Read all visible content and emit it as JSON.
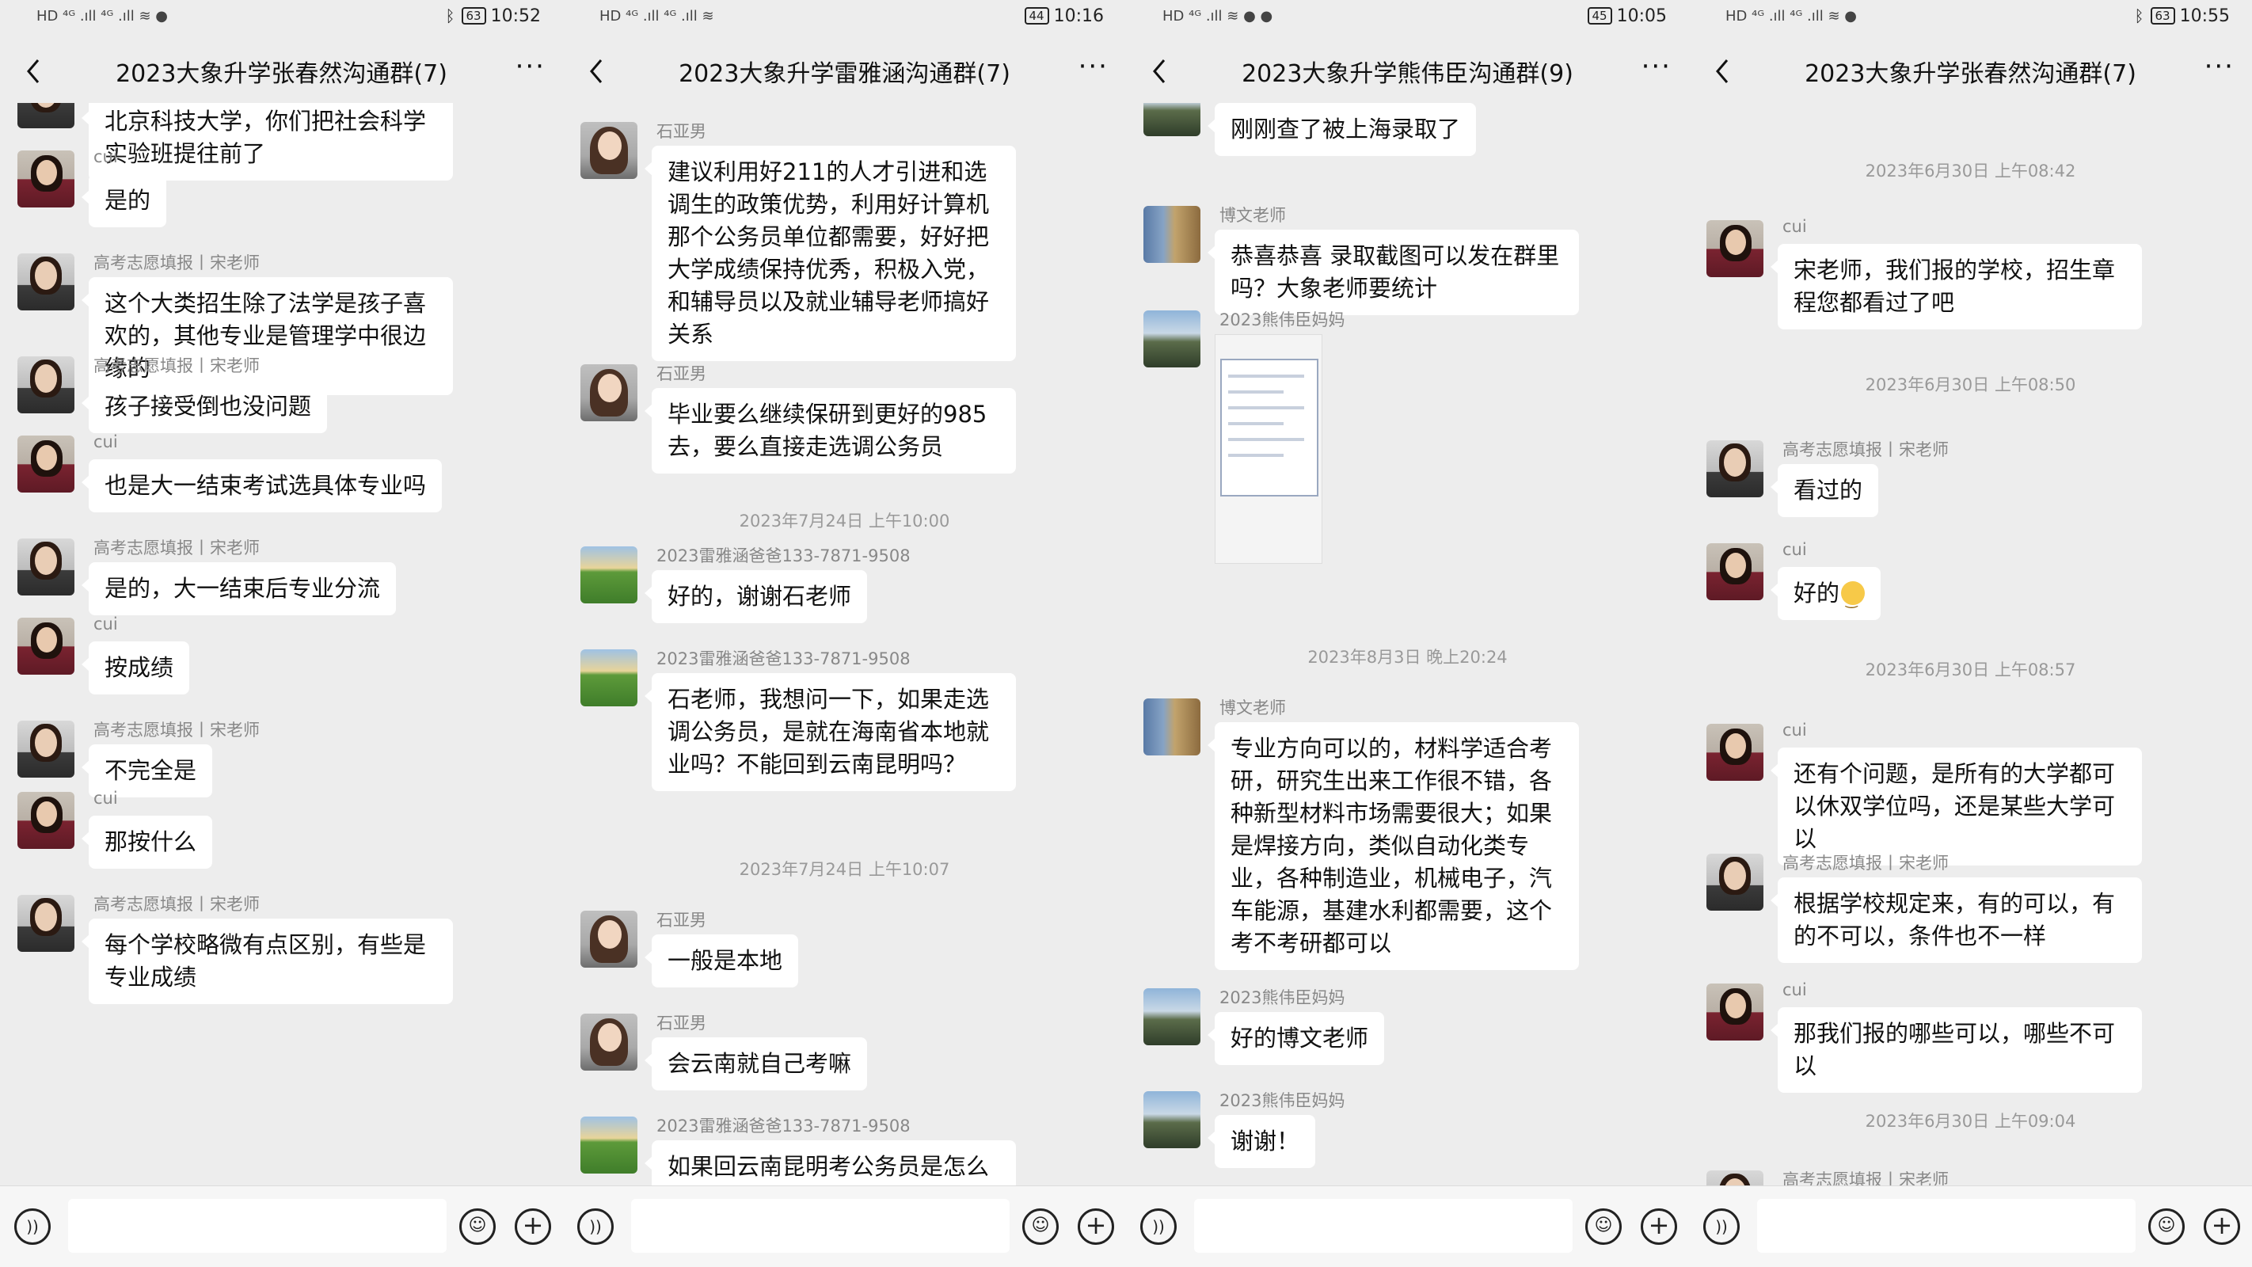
{
  "screens": [
    {
      "status": {
        "left": "HD ⁴ᴳ .ıll ⁴ᴳ .ıll ≋ ●",
        "battery": "63",
        "time": "10:52",
        "bluetooth": true
      },
      "title": "2023大象升学张春然沟通群(7)",
      "items": [
        {
          "kind": "msg",
          "avatar": "person",
          "sender": "高考志愿填报丨宋老师",
          "text": "北京科技大学，你们把社会科学实验班提往前了"
        },
        {
          "kind": "msg",
          "avatar": "cui",
          "sender": "cui",
          "text": "是的"
        },
        {
          "kind": "msg",
          "avatar": "person",
          "sender": "高考志愿填报丨宋老师",
          "text": "这个大类招生除了法学是孩子喜欢的，其他专业是管理学中很边缘的"
        },
        {
          "kind": "msg",
          "avatar": "person",
          "sender": "高考志愿填报丨宋老师",
          "text": "孩子接受倒也没问题"
        },
        {
          "kind": "msg",
          "avatar": "cui",
          "sender": "cui",
          "text": "也是大一结束考试选具体专业吗"
        },
        {
          "kind": "msg",
          "avatar": "person",
          "sender": "高考志愿填报丨宋老师",
          "text": "是的，大一结束后专业分流"
        },
        {
          "kind": "msg",
          "avatar": "cui",
          "sender": "cui",
          "text": "按成绩"
        },
        {
          "kind": "msg",
          "avatar": "person",
          "sender": "高考志愿填报丨宋老师",
          "text": "不完全是"
        },
        {
          "kind": "msg",
          "avatar": "cui",
          "sender": "cui",
          "text": "那按什么"
        },
        {
          "kind": "msg",
          "avatar": "person",
          "sender": "高考志愿填报丨宋老师",
          "text": "每个学校略微有点区别，有些是专业成绩"
        }
      ]
    },
    {
      "status": {
        "left": "HD ⁴ᴳ .ıll ⁴ᴳ .ıll ≋",
        "battery": "44",
        "time": "10:16",
        "bluetooth": false
      },
      "title": "2023大象升学雷雅涵沟通群(7)",
      "items": [
        {
          "kind": "msg",
          "avatar": "shi",
          "sender": "石亚男",
          "text": "建议利用好211的人才引进和选调生的政策优势，利用好计算机那个公务员单位都需要，好好把大学成绩保持优秀，积极入党，和辅导员以及就业辅导老师搞好关系"
        },
        {
          "kind": "msg",
          "avatar": "shi",
          "sender": "石亚男",
          "text": "毕业要么继续保研到更好的985去，要么直接走选调公务员"
        },
        {
          "kind": "time",
          "text": "2023年7月24日 上午10:00"
        },
        {
          "kind": "msg",
          "avatar": "field",
          "sender": "2023雷雅涵爸爸133-7871-9508",
          "text": "好的，谢谢石老师"
        },
        {
          "kind": "msg",
          "avatar": "field",
          "sender": "2023雷雅涵爸爸133-7871-9508",
          "text": "石老师，我想问一下，如果走选调公务员，是就在海南省本地就业吗？不能回到云南昆明吗？"
        },
        {
          "kind": "time",
          "text": "2023年7月24日 上午10:07"
        },
        {
          "kind": "msg",
          "avatar": "shi",
          "sender": "石亚男",
          "text": "一般是本地"
        },
        {
          "kind": "msg",
          "avatar": "shi",
          "sender": "石亚男",
          "text": "会云南就自己考嘛"
        },
        {
          "kind": "msg",
          "avatar": "field",
          "sender": "2023雷雅涵爸爸133-7871-9508",
          "text": "如果回云南昆明考公务员是怎么考"
        }
      ]
    },
    {
      "status": {
        "left": "HD ⁴ᴳ .ıll ≋ ● ●",
        "battery": "45",
        "time": "10:05",
        "bluetooth": false
      },
      "title": "2023大象升学熊伟臣沟通群(9)",
      "items": [
        {
          "kind": "msg",
          "avatar": "mountain",
          "sender": "2023熊伟臣妈妈",
          "text": "刚刚查了被上海录取了"
        },
        {
          "kind": "msg",
          "avatar": "rock",
          "sender": "博文老师",
          "text": "恭喜恭喜 录取截图可以发在群里吗？大象老师要统计"
        },
        {
          "kind": "img",
          "avatar": "mountain",
          "sender": "2023熊伟臣妈妈"
        },
        {
          "kind": "time",
          "text": "2023年8月3日 晚上20:24"
        },
        {
          "kind": "msg",
          "avatar": "rock",
          "sender": "博文老师",
          "text": "专业方向可以的，材料学适合考研，研究生出来工作很不错，各种新型材料市场需要很大；如果是焊接方向，类似自动化类专业，各种制造业，机械电子，汽车能源，基建水利都需要，这个考不考研都可以"
        },
        {
          "kind": "msg",
          "avatar": "mountain",
          "sender": "2023熊伟臣妈妈",
          "text": "好的博文老师"
        },
        {
          "kind": "msg",
          "avatar": "mountain",
          "sender": "2023熊伟臣妈妈",
          "text": "谢谢！"
        }
      ]
    },
    {
      "status": {
        "left": "HD ⁴ᴳ .ıll ⁴ᴳ .ıll ≋ ●",
        "battery": "63",
        "time": "10:55",
        "bluetooth": true
      },
      "title": "2023大象升学张春然沟通群(7)",
      "items": [
        {
          "kind": "time",
          "text": "2023年6月30日 上午08:42"
        },
        {
          "kind": "msg",
          "avatar": "cui",
          "sender": "cui",
          "text": "宋老师，我们报的学校，招生章程您都看过了吧"
        },
        {
          "kind": "time",
          "text": "2023年6月30日 上午08:50"
        },
        {
          "kind": "msg",
          "avatar": "person",
          "sender": "高考志愿填报丨宋老师",
          "text": "看过的"
        },
        {
          "kind": "msg",
          "avatar": "cui",
          "sender": "cui",
          "text": "好的",
          "emoji": true
        },
        {
          "kind": "time",
          "text": "2023年6月30日 上午08:57"
        },
        {
          "kind": "msg",
          "avatar": "cui",
          "sender": "cui",
          "text": "还有个问题，是所有的大学都可以休双学位吗，还是某些大学可以"
        },
        {
          "kind": "msg",
          "avatar": "person",
          "sender": "高考志愿填报丨宋老师",
          "text": "根据学校规定来，有的可以，有的不可以，条件也不一样"
        },
        {
          "kind": "msg",
          "avatar": "cui",
          "sender": "cui",
          "text": "那我们报的哪些可以，哪些不可以"
        },
        {
          "kind": "time",
          "text": "2023年6月30日 上午09:04"
        },
        {
          "kind": "msg",
          "avatar": "person",
          "sender": "高考志愿填报丨宋老师",
          "text": ""
        }
      ]
    }
  ]
}
